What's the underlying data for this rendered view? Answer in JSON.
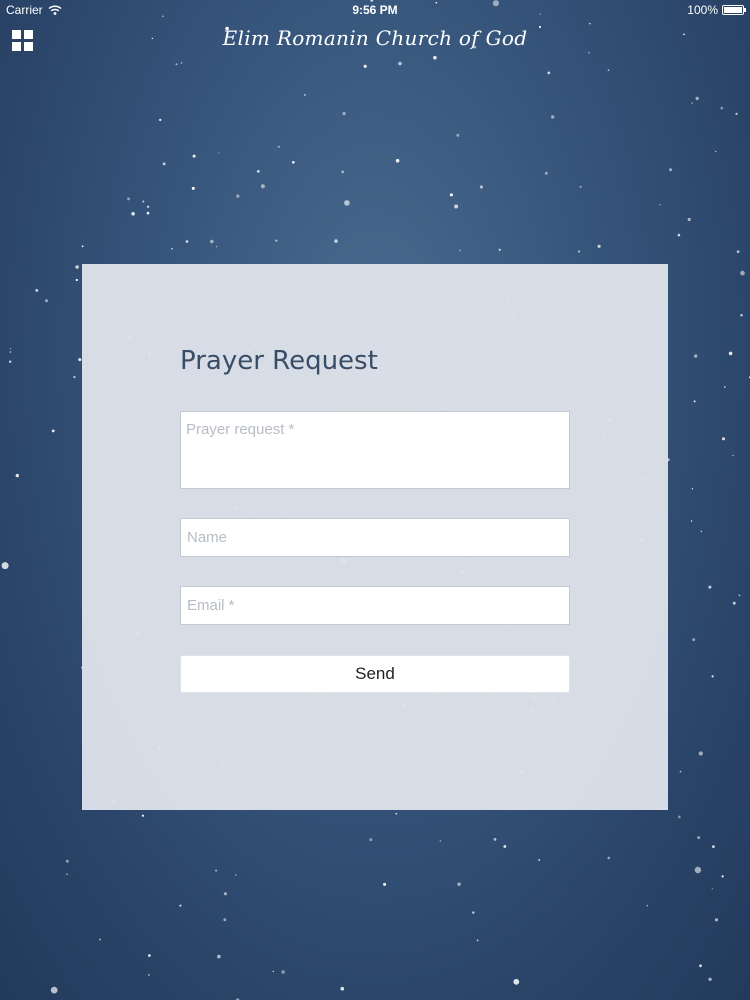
{
  "status_bar": {
    "carrier": "Carrier",
    "time": "9:56 PM",
    "battery": "100%",
    "battery_level": 1.0
  },
  "header": {
    "title": "Elim Romanin Church of God",
    "menu_icon": "grid-icon"
  },
  "form": {
    "title": "Prayer Request",
    "prayer_request": {
      "value": "",
      "placeholder": "Prayer request *"
    },
    "name": {
      "value": "",
      "placeholder": "Name"
    },
    "email": {
      "value": "",
      "placeholder": "Email *"
    },
    "send_label": "Send"
  },
  "colors": {
    "background": "#35547a",
    "card": "#dee2ea",
    "title_text": "#3a4d66"
  }
}
